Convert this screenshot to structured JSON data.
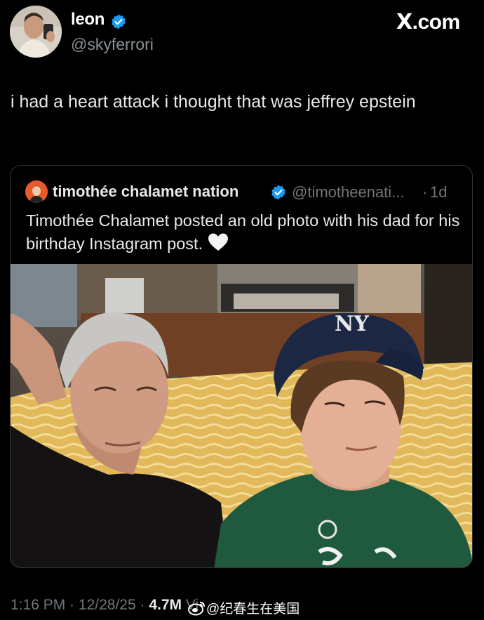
{
  "header": {
    "author_name": "leon",
    "author_handle": "@skyferrori",
    "site_label": ".com",
    "site_mark": "X"
  },
  "tweet": {
    "text": "i had a heart attack i thought that was jeffrey epstein"
  },
  "quote": {
    "author_name": "timothée chalamet nation",
    "author_handle": "@timotheenati...",
    "separator": "·",
    "time": "1d",
    "text": "Timothée Chalamet posted an old photo with his dad for his birthday Instagram post."
  },
  "meta": {
    "time": "1:16 PM",
    "separator1": " · ",
    "date": "12/28/25",
    "separator2": " · ",
    "views": "4.7M",
    "views_suffix": " Vi"
  },
  "watermark": {
    "text": "@纪春生在美国"
  },
  "colors": {
    "background": "#000000",
    "text": "#e7e9ea",
    "secondary": "#71767b",
    "verified": "#1d9bf0",
    "border": "#2f3336"
  },
  "icons": {
    "verified": "verified-badge-icon",
    "heart": "white-heart-icon",
    "weibo": "weibo-logo-icon"
  }
}
